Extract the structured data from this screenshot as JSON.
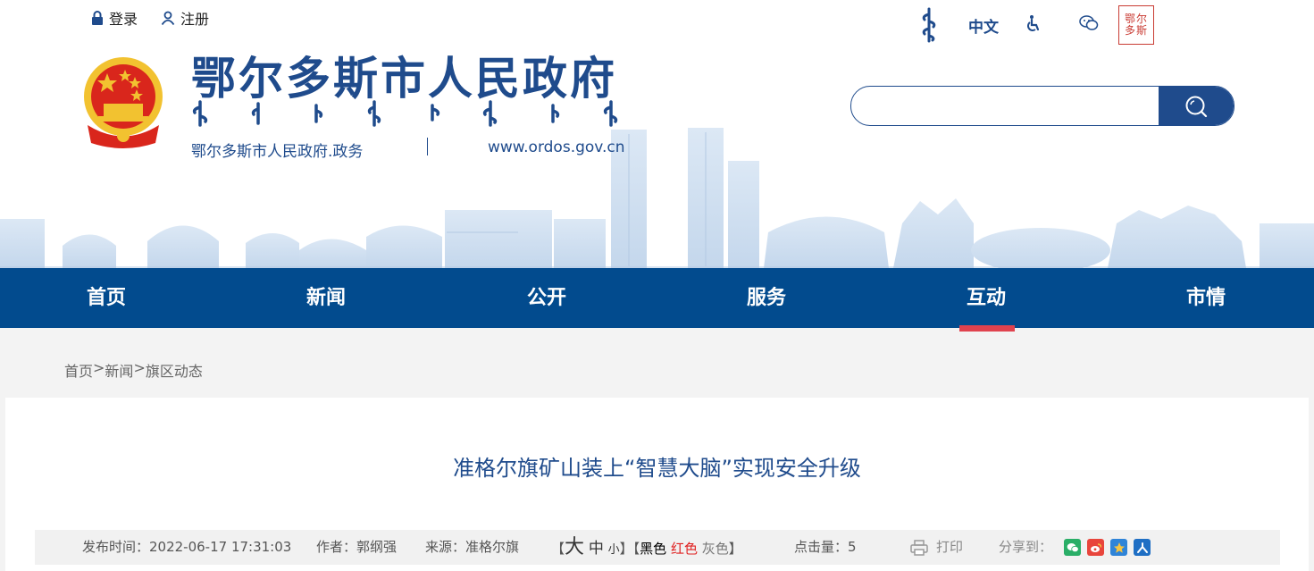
{
  "topbar": {
    "login_label": "登录",
    "register_label": "注册",
    "lang_label": "中文",
    "ordos_logo_text": [
      "鄂尔",
      "多斯"
    ]
  },
  "header": {
    "site_title": "鄂尔多斯市人民政府",
    "sub_left": "鄂尔多斯市人民政府.政务",
    "sub_right": "www.ordos.gov.cn"
  },
  "search": {
    "placeholder": ""
  },
  "nav": {
    "items": [
      "首页",
      "新闻",
      "公开",
      "服务",
      "互动",
      "市情"
    ],
    "active": "互动"
  },
  "breadcrumb": {
    "home": "首页",
    "sep": ">",
    "news": "新闻",
    "current": "旗区动态"
  },
  "article": {
    "title": "准格尔旗矿山装上“智慧大脑”实现安全升级"
  },
  "meta": {
    "publish_time": "发布时间：2022-06-17 17:31:03",
    "author": "作者：郭纲强",
    "source": "来源：准格尔旗",
    "bracket_open": "【",
    "bracket_close": "】",
    "font_large": "大",
    "font_medium": "中",
    "font_small": "小",
    "color_black": "黑色",
    "color_red": "红色",
    "color_gray": "灰色",
    "views": "点击量：5",
    "print": "打印",
    "share": "分享到："
  },
  "colors": {
    "brand_blue": "#1f4b8c",
    "nav_blue": "#024b8e",
    "active_red": "#e0424e"
  },
  "icons": {
    "login": "lock-icon",
    "register": "user-icon",
    "accessibility": "wheelchair-icon",
    "wechat": "wechat-icon",
    "search": "search-icon",
    "print": "printer-icon",
    "share": [
      "wechat-share-icon",
      "weibo-share-icon",
      "qzone-share-icon",
      "renren-share-icon"
    ]
  }
}
